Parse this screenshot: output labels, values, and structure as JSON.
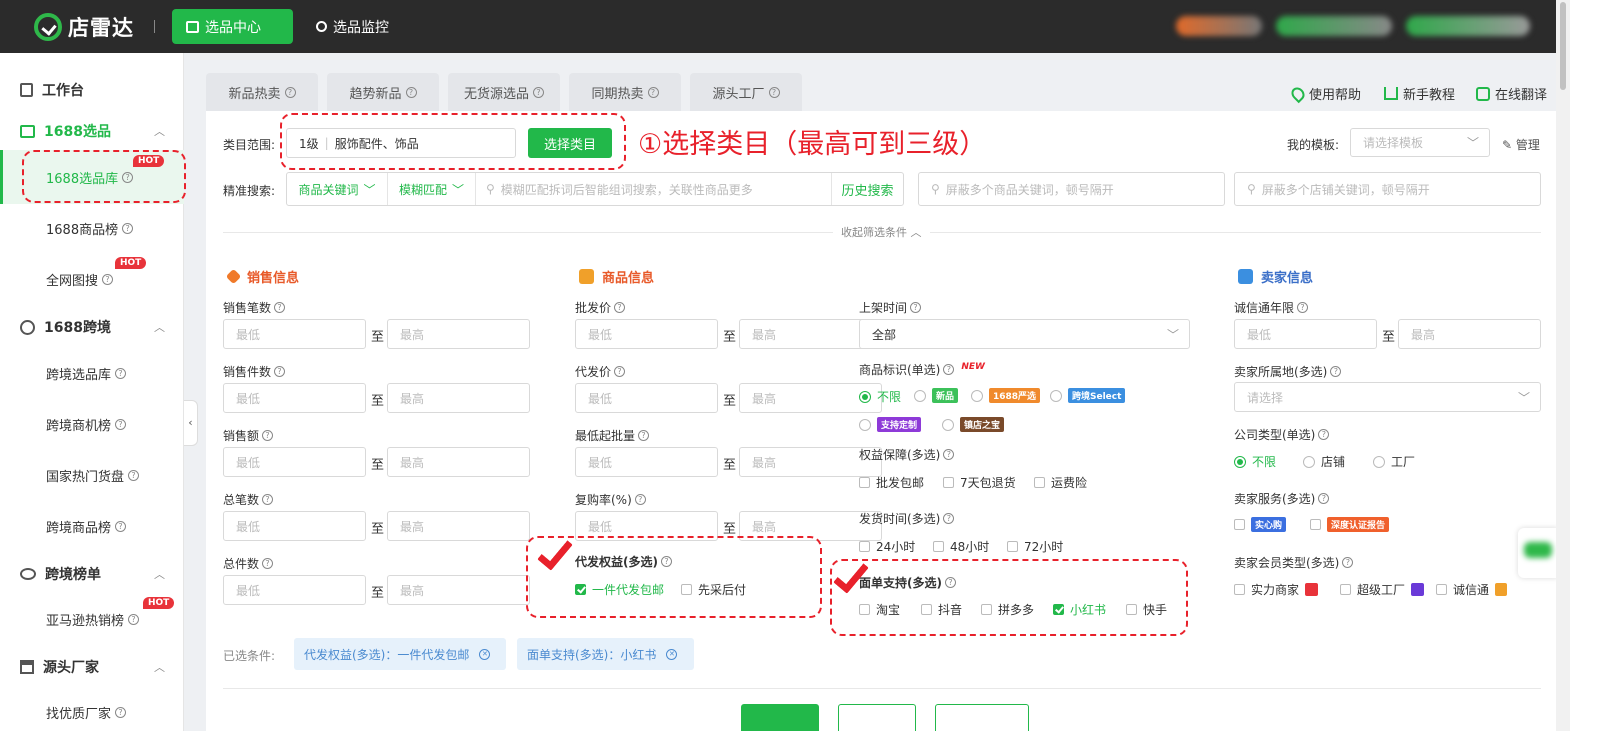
{
  "header": {
    "logo_text": "店雷达",
    "nav": [
      {
        "label": "选品中心",
        "active": true,
        "icon": "bag-icon"
      },
      {
        "label": "选品监控",
        "active": false,
        "icon": "location-pin-icon"
      }
    ],
    "accent": "#22b84a"
  },
  "sidebar": {
    "workbench": "工作台",
    "groups": [
      {
        "label": "1688选品",
        "items": [
          {
            "label": "1688选品库",
            "hot": "HOT",
            "active": true
          },
          {
            "label": "1688商品榜"
          },
          {
            "label": "全网图搜",
            "hot": "HOT"
          }
        ]
      },
      {
        "label": "1688跨境",
        "items": [
          {
            "label": "跨境选品库"
          },
          {
            "label": "跨境商机榜"
          },
          {
            "label": "国家热门货盘"
          },
          {
            "label": "跨境商品榜"
          }
        ]
      },
      {
        "label": "跨境榜单",
        "items": [
          {
            "label": "亚马逊热销榜",
            "hot": "HOT"
          }
        ]
      },
      {
        "label": "源头厂家",
        "items": [
          {
            "label": "找优质厂家"
          }
        ]
      }
    ]
  },
  "tabs": [
    "新品热卖",
    "趋势新品",
    "无货源选品",
    "同期热卖",
    "源头工厂"
  ],
  "help_links": [
    "使用帮助",
    "新手教程",
    "在线翻译"
  ],
  "category": {
    "label": "类目范围:",
    "level": "1级",
    "value": "服饰配件、饰品",
    "button": "选择类目",
    "annotation": "①选择类目（最高可到三级）"
  },
  "template": {
    "label": "我的模板:",
    "placeholder": "请选择模板",
    "manage": "管理"
  },
  "search": {
    "label": "精准搜索:",
    "keyword_type": "商品关键词",
    "match_type": "模糊匹配",
    "placeholder": "模糊匹配拆词后智能组词搜索，关联性商品更多",
    "history": "历史搜索",
    "exclude_goods_placeholder": "屏蔽多个商品关键词，顿号隔开",
    "exclude_shops_placeholder": "屏蔽多个店铺关键词，顿号隔开"
  },
  "collapse_label": "收起筛选条件",
  "range": {
    "min": "最低",
    "max": "最高",
    "sep": "至"
  },
  "sales": {
    "title": "销售信息",
    "fields": [
      "销售笔数",
      "销售件数",
      "销售额",
      "总笔数",
      "总件数"
    ]
  },
  "goods": {
    "title": "商品信息",
    "fields": [
      "批发价",
      "代发价",
      "最低起批量",
      "复购率(%)"
    ],
    "dropship": {
      "label": "代发权益(多选)",
      "options": [
        {
          "label": "一件代发包邮",
          "checked": true
        },
        {
          "label": "先采后付",
          "checked": false
        }
      ]
    }
  },
  "middle": {
    "listing_time": {
      "label": "上架时间",
      "value": "全部"
    },
    "tag": {
      "label": "商品标识(单选)",
      "new": "NEW",
      "options": [
        {
          "label": "不限",
          "checked": true
        },
        {
          "label": "新品",
          "color": "#3cc15a"
        },
        {
          "label": "1688严选",
          "color": "#f08a2c"
        },
        {
          "label": "跨境Select",
          "color": "#3b8fe0"
        },
        {
          "label": "支持定制",
          "color": "#8e3ad8"
        },
        {
          "label": "镇店之宝",
          "color": "#7a4a2a"
        }
      ]
    },
    "rights": {
      "label": "权益保障(多选)",
      "options": [
        "批发包邮",
        "7天包退货",
        "运费险"
      ]
    },
    "ship_time": {
      "label": "发货时间(多选)",
      "options": [
        "24小时",
        "48小时",
        "72小时"
      ]
    },
    "waybill": {
      "label": "面单支持(多选)",
      "options": [
        {
          "label": "淘宝",
          "checked": false
        },
        {
          "label": "抖音",
          "checked": false
        },
        {
          "label": "拼多多",
          "checked": false
        },
        {
          "label": "小红书",
          "checked": true
        },
        {
          "label": "快手",
          "checked": false
        }
      ]
    }
  },
  "seller": {
    "title": "卖家信息",
    "years": "诚信通年限",
    "location": {
      "label": "卖家所属地(多选)",
      "placeholder": "请选择"
    },
    "company": {
      "label": "公司类型(单选)",
      "options": [
        {
          "label": "不限",
          "checked": true
        },
        {
          "label": "店铺",
          "checked": false
        },
        {
          "label": "工厂",
          "checked": false
        }
      ]
    },
    "service": {
      "label": "卖家服务(多选)",
      "options": [
        {
          "label": "实心购",
          "color": "#3b6fe0"
        },
        {
          "label": "深度认证报告",
          "color": "#f0602c"
        }
      ]
    },
    "member": {
      "label": "卖家会员类型(多选)",
      "options": [
        "实力商家",
        "超级工厂",
        "诚信通"
      ]
    }
  },
  "selected": {
    "label": "已选条件:",
    "chips": [
      "代发权益(多选)：一件代发包邮",
      "面单支持(多选)：小红书"
    ]
  },
  "annotation_color": "#e8212b"
}
